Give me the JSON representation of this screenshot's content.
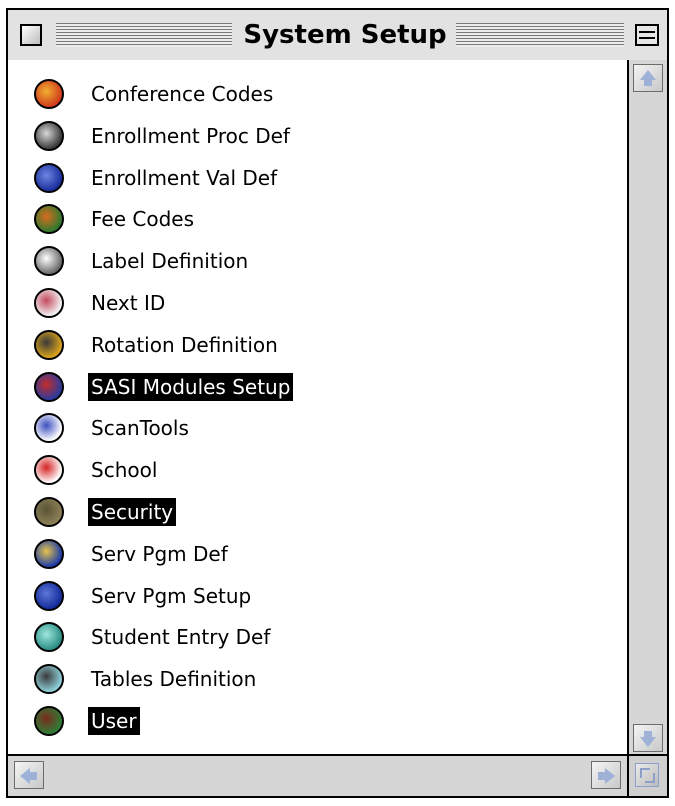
{
  "window": {
    "title": "System Setup"
  },
  "items": [
    {
      "label": "Conference Codes",
      "icon": "conference-codes-icon",
      "selected": false,
      "colors": [
        "#d13b1c",
        "#f0b030"
      ]
    },
    {
      "label": "Enrollment Proc Def",
      "icon": "enrollment-proc-icon",
      "selected": false,
      "colors": [
        "#3a3a3a",
        "#d8d8d8"
      ]
    },
    {
      "label": "Enrollment Val Def",
      "icon": "enrollment-val-icon",
      "selected": false,
      "colors": [
        "#1a2f9e",
        "#6d86e0"
      ]
    },
    {
      "label": "Fee Codes",
      "icon": "fee-codes-icon",
      "selected": false,
      "colors": [
        "#2f7a2f",
        "#d96b1e"
      ]
    },
    {
      "label": "Label Definition",
      "icon": "label-definition-icon",
      "selected": false,
      "colors": [
        "#6a6a6a",
        "#ffffff"
      ]
    },
    {
      "label": "Next ID",
      "icon": "next-id-icon",
      "selected": false,
      "colors": [
        "#f2f2f2",
        "#c44a5e"
      ]
    },
    {
      "label": "Rotation Definition",
      "icon": "rotation-definition-icon",
      "selected": false,
      "colors": [
        "#d9a21b",
        "#3a3a3a"
      ]
    },
    {
      "label": "SASI Modules Setup",
      "icon": "sasi-modules-icon",
      "selected": true,
      "colors": [
        "#2b3b9c",
        "#c22c2c"
      ]
    },
    {
      "label": "ScanTools",
      "icon": "scantools-icon",
      "selected": false,
      "colors": [
        "#ffffff",
        "#3d4fbf"
      ]
    },
    {
      "label": "School",
      "icon": "school-icon",
      "selected": false,
      "colors": [
        "#ffffff",
        "#d62323"
      ]
    },
    {
      "label": "Security",
      "icon": "security-lock-icon",
      "selected": true,
      "colors": [
        "#8c7f56",
        "#5a5436"
      ]
    },
    {
      "label": "Serv Pgm Def",
      "icon": "serv-pgm-def-icon",
      "selected": false,
      "colors": [
        "#1d3ea8",
        "#e6c24a"
      ]
    },
    {
      "label": "Serv Pgm Setup",
      "icon": "serv-pgm-setup-icon",
      "selected": false,
      "colors": [
        "#142c9a",
        "#5d77d8"
      ]
    },
    {
      "label": "Student Entry Def",
      "icon": "student-entry-icon",
      "selected": false,
      "colors": [
        "#2c8f86",
        "#9fe6dd"
      ]
    },
    {
      "label": "Tables Definition",
      "icon": "tables-definition-icon",
      "selected": false,
      "colors": [
        "#8ed0d9",
        "#3a3a3a"
      ]
    },
    {
      "label": "User",
      "icon": "user-icon",
      "selected": true,
      "colors": [
        "#2f7d35",
        "#7a2a1e"
      ]
    }
  ],
  "colors": {
    "selection_bg": "#000000",
    "selection_text": "#ffffff",
    "scroll_arrow": "#9eb2d8"
  }
}
